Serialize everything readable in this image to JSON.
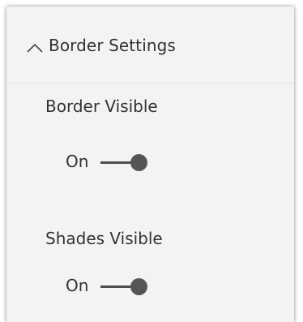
{
  "section": {
    "title": "Border Settings",
    "expanded": true,
    "chevron_icon": "chevron-up-icon"
  },
  "settings": [
    {
      "label": "Border Visible",
      "toggle_label": "On",
      "value": true
    },
    {
      "label": "Shades Visible",
      "toggle_label": "On",
      "value": true
    }
  ],
  "colors": {
    "panel_bg": "#f3f3f3",
    "text": "#333333",
    "toggle": "#555555"
  }
}
